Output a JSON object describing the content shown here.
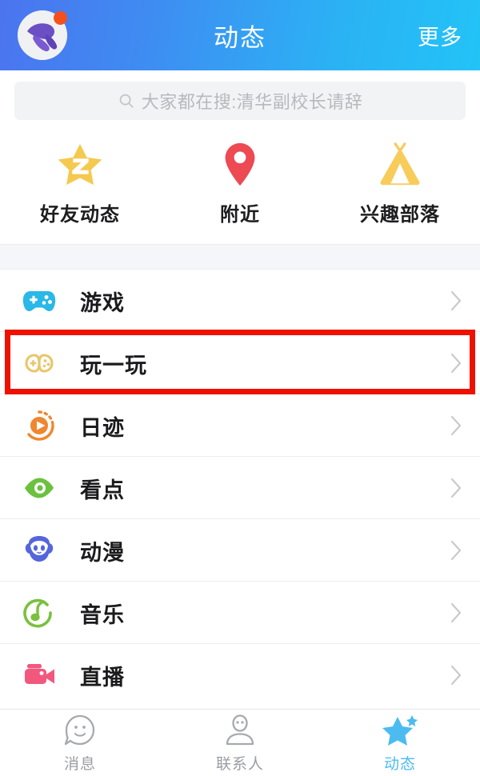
{
  "header": {
    "title": "动态",
    "more_label": "更多",
    "avatar_name": "user-avatar",
    "badge": ""
  },
  "search": {
    "placeholder": "大家都在搜:清华副校长请辞",
    "icon": "search-icon"
  },
  "quick_actions": [
    {
      "label": "好友动态",
      "icon": "star-z-icon",
      "color": "#f5c94e"
    },
    {
      "label": "附近",
      "icon": "location-pin-icon",
      "color": "#ed4a53"
    },
    {
      "label": "兴趣部落",
      "icon": "tent-icon",
      "color": "#f7cc5a"
    }
  ],
  "list": [
    {
      "label": "游戏",
      "icon": "gamepad-icon",
      "color": "#29b8e8"
    },
    {
      "label": "玩一玩",
      "icon": "double-gamepad-icon",
      "color": "#e8c66a",
      "highlighted": true
    },
    {
      "label": "日迹",
      "icon": "play-circle-icon",
      "color": "#f0862e"
    },
    {
      "label": "看点",
      "icon": "eye-icon",
      "color": "#6cc13e"
    },
    {
      "label": "动漫",
      "icon": "anime-face-icon",
      "color": "#5566dd"
    },
    {
      "label": "音乐",
      "icon": "music-note-icon",
      "color": "#7ac13e"
    },
    {
      "label": "直播",
      "icon": "video-camera-icon",
      "color": "#f2587e"
    }
  ],
  "tabs": [
    {
      "label": "消息",
      "icon": "chat-smiley-icon",
      "active": false
    },
    {
      "label": "联系人",
      "icon": "person-icon",
      "active": false
    },
    {
      "label": "动态",
      "icon": "star-icon",
      "active": true
    }
  ],
  "colors": {
    "header_gradient_start": "#4b74ef",
    "header_gradient_end": "#22c3f7",
    "highlight_box": "#ee1100",
    "active_tab": "#4cbcf0",
    "band": "#f4f6f9"
  }
}
